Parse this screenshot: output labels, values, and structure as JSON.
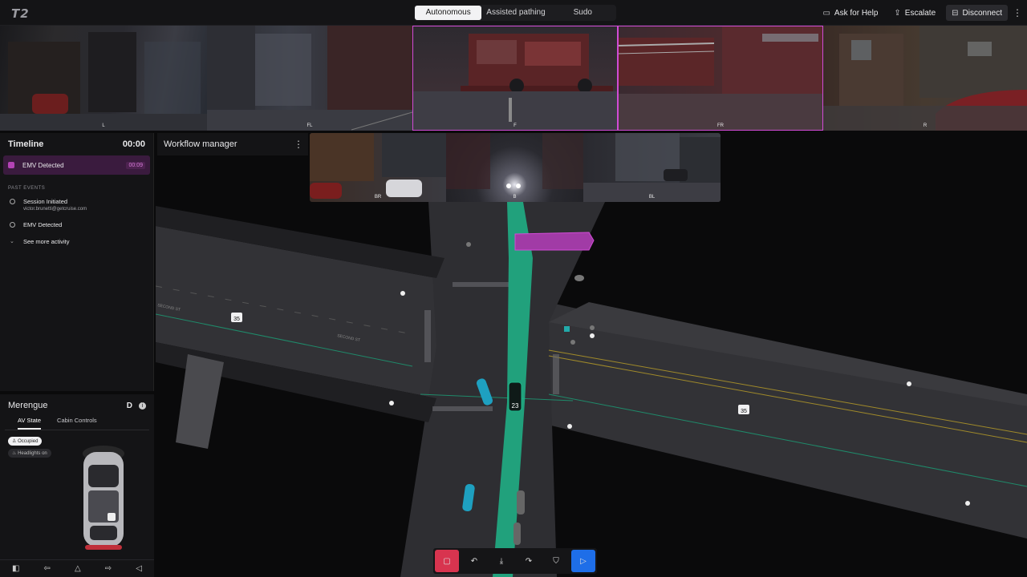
{
  "app": {
    "logo": "T2"
  },
  "modes": [
    {
      "label": "Autonomous",
      "active": true
    },
    {
      "label": "Assisted pathing",
      "active": false
    },
    {
      "label": "Sudo",
      "active": false
    }
  ],
  "actions": {
    "help": "Ask for Help",
    "escalate": "Escalate",
    "disconnect": "Disconnect"
  },
  "cameras": {
    "front": [
      "L",
      "FL",
      "F",
      "FR",
      "R"
    ],
    "rear": [
      "BR",
      "B",
      "BL"
    ]
  },
  "timeline": {
    "title": "Timeline",
    "clock": "00:00",
    "current": {
      "label": "EMV Detected",
      "time": "00:09"
    },
    "past_title": "PAST EVENTS",
    "past": [
      {
        "label": "Session Initiated",
        "sub": "victor.brunetti@getcruise.com"
      },
      {
        "label": "EMV Detected",
        "sub": ""
      },
      {
        "label": "See more activity",
        "sub": ""
      }
    ]
  },
  "workflow": {
    "title": "Workflow manager"
  },
  "vehicle": {
    "name": "Merengue",
    "gear": "D",
    "tabs": [
      {
        "label": "AV State",
        "active": true
      },
      {
        "label": "Cabin Controls",
        "active": false
      }
    ],
    "status_occupied": "Occupied",
    "status_headlights": "Headlights on"
  },
  "map": {
    "street_1": "SECOND ST",
    "street_2": "SECOND ST",
    "speed_limit": "35",
    "ego_number": "23"
  },
  "colors": {
    "accent": "#d14bd6",
    "path": "#1fb58a",
    "stop": "#d8344f",
    "go": "#1e6ee8"
  }
}
